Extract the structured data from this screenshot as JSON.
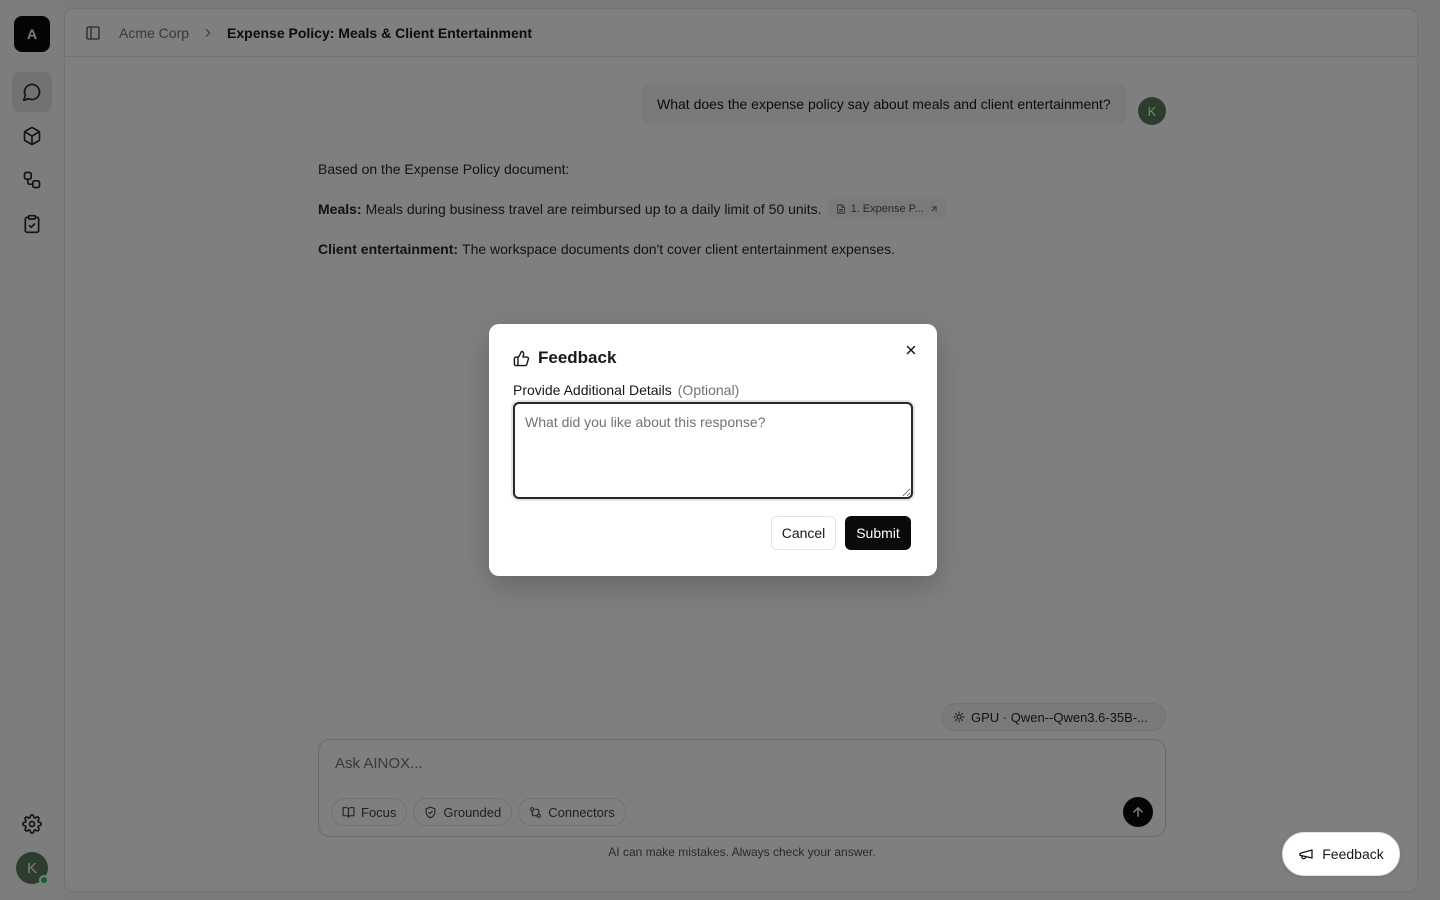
{
  "app": {
    "logo_letter": "A",
    "user_initial": "K"
  },
  "rail": {
    "items": [
      {
        "icon": "chat-icon",
        "active": true
      },
      {
        "icon": "cube-icon",
        "active": false
      },
      {
        "icon": "workflow-icon",
        "active": false
      },
      {
        "icon": "clipboard-check-icon",
        "active": false
      }
    ],
    "settings_icon": "gear-icon"
  },
  "breadcrumb": {
    "workspace": "Acme Corp",
    "page": "Expense Policy: Meals & Client Entertainment"
  },
  "conversation": {
    "user_message": "What does the expense policy say about meals and client entertainment?",
    "answer_intro": "Based on the Expense Policy document:",
    "meals_label": "Meals:",
    "meals_text": "Meals during business travel are reimbursed up to a daily limit of 50 units.",
    "citation_label": "1. Expense P...",
    "entertainment_label": "Client entertainment:",
    "entertainment_text": "The workspace documents don't cover client entertainment expenses."
  },
  "composer": {
    "model": "GPU · Qwen--Qwen3.6-35B-...",
    "placeholder": "Ask AINOX...",
    "pills": {
      "focus": "Focus",
      "grounded": "Grounded",
      "connectors": "Connectors"
    },
    "disclaimer": "AI can make mistakes. Always check your answer."
  },
  "feedback_fab": {
    "label": "Feedback"
  },
  "dialog": {
    "title": "Feedback",
    "field_label": "Provide Additional Details",
    "field_optional": "(Optional)",
    "placeholder": "What did you like about this response?",
    "value": "",
    "cancel_label": "Cancel",
    "submit_label": "Submit"
  }
}
